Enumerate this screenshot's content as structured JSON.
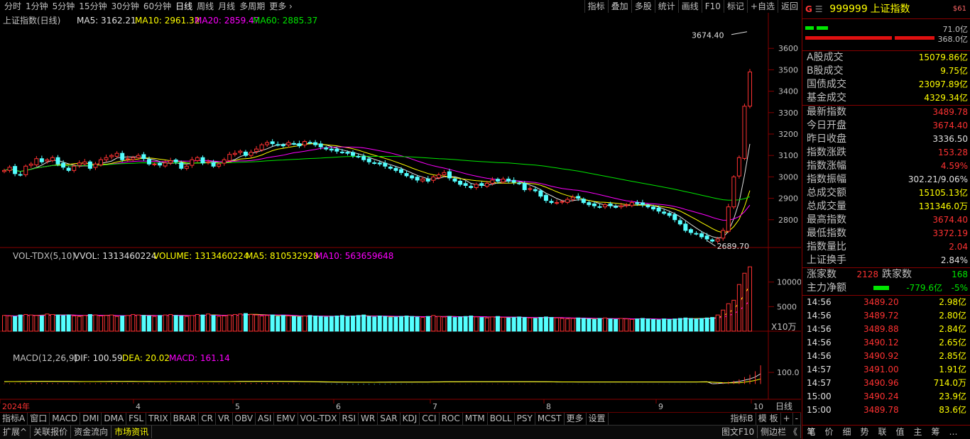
{
  "top_menu": {
    "periods": [
      "分时",
      "1分钟",
      "5分钟",
      "15分钟",
      "30分钟",
      "60分钟",
      "日线",
      "周线",
      "月线",
      "多周期",
      "更多 ›"
    ],
    "active": "日线",
    "right_buttons": [
      "指标",
      "叠加",
      "多股",
      "统计",
      "画线",
      "F10",
      "标记",
      "+自选",
      "返回"
    ]
  },
  "chart_header": {
    "name": "上证指数(日线)",
    "ma5": "MA5: 3162.21",
    "ma10": "MA10: 2961.32",
    "ma20": "MA20: 2859.47",
    "ma60": "MA60: 2885.37"
  },
  "annotations": {
    "high": "3674.40",
    "low": "2689.70"
  },
  "price_axis": [
    "3600",
    "3500",
    "3400",
    "3300",
    "3200",
    "3100",
    "3000",
    "2900",
    "2800"
  ],
  "vol_header": {
    "name": "VOL-TDX(5,10)",
    "vvol": "VVOL: 1313460224",
    "volume": "VOLUME: 1313460224",
    "ma5": "MA5: 810532928",
    "ma10": "MA10: 563659648"
  },
  "vol_axis": [
    "10000",
    "5000"
  ],
  "vol_unit": "X10万",
  "macd_header": {
    "name": "MACD(12,26,9)",
    "dif": "DIF: 100.59",
    "dea": "DEA: 20.02",
    "macd": "MACD: 161.14"
  },
  "macd_axis": [
    "100.0"
  ],
  "time_axis": [
    "2024年",
    "4",
    "5",
    "6",
    "7",
    "8",
    "9",
    "10"
  ],
  "period_label": "日线",
  "chart_data": {
    "type": "candlestick",
    "title": "上证指数(日线)",
    "annotations": {
      "high": 3674.4,
      "low": 2689.7
    },
    "last_ma": {
      "MA5": 3162.21,
      "MA10": 2961.32,
      "MA20": 2859.47,
      "MA60": 2885.37
    },
    "ylim": [
      2700,
      3700
    ],
    "vol_ylim": [
      0,
      14000
    ],
    "macd_ylim": [
      -40,
      180
    ],
    "last_volume": 1313460224,
    "last_vol_ma": {
      "MA5": 810532928,
      "MA10": 563659648
    },
    "last_macd": {
      "DIF": 100.59,
      "DEA": 20.02,
      "MACD": 161.14
    },
    "closes": [
      3030,
      3045,
      3015,
      3010,
      3050,
      3060,
      3085,
      3070,
      3080,
      3090,
      3060,
      3045,
      3030,
      3050,
      3065,
      3070,
      3040,
      3060,
      3080,
      3090,
      3100,
      3110,
      3080,
      3085,
      3090,
      3100,
      3085,
      3060,
      3060,
      3055,
      3065,
      3075,
      3070,
      3040,
      3050,
      3080,
      3090,
      3065,
      3070,
      3050,
      3060,
      3080,
      3105,
      3110,
      3120,
      3100,
      3115,
      3130,
      3150,
      3160,
      3155,
      3150,
      3145,
      3160,
      3155,
      3145,
      3165,
      3160,
      3150,
      3140,
      3130,
      3125,
      3120,
      3115,
      3110,
      3100,
      3095,
      3080,
      3070,
      3065,
      3060,
      3050,
      3040,
      3030,
      3020,
      3005,
      2995,
      2985,
      2990,
      2980,
      3000,
      3010,
      3020,
      2995,
      2980,
      2965,
      2960,
      2950,
      2965,
      2960,
      2970,
      2985,
      2980,
      2990,
      2980,
      2975,
      2970,
      2940,
      2945,
      2935,
      2910,
      2890,
      2880,
      2880,
      2885,
      2895,
      2905,
      2900,
      2880,
      2870,
      2865,
      2860,
      2870,
      2865,
      2860,
      2865,
      2870,
      2880,
      2875,
      2870,
      2860,
      2850,
      2840,
      2830,
      2820,
      2800,
      2780,
      2750,
      2740,
      2735,
      2720,
      2710,
      2700,
      2710,
      2750,
      2860,
      3000,
      3090,
      3330,
      3490
    ],
    "volumes": [
      3200,
      3100,
      3000,
      3300,
      3400,
      3300,
      3200,
      3100,
      3500,
      3400,
      3300,
      3200,
      3300,
      3100,
      3000,
      3200,
      3400,
      3300,
      3100,
      3200,
      3300,
      3000,
      3100,
      3200,
      3400,
      3300,
      3200,
      3100,
      3000,
      3200,
      3300,
      3400,
      3200,
      3100,
      3000,
      3200,
      3400,
      3300,
      3500,
      3200,
      3000,
      3100,
      3300,
      3400,
      3500,
      3600,
      3400,
      3300,
      3100,
      3200,
      3300,
      3000,
      3200,
      3100,
      3000,
      2900,
      3100,
      3200,
      3100,
      3000,
      2900,
      3000,
      3100,
      3200,
      3000,
      3100,
      3200,
      3300,
      3000,
      2900,
      3100,
      3000,
      2800,
      2900,
      3000,
      3100,
      3000,
      2900,
      2800,
      3000,
      3200,
      3000,
      2900,
      3000,
      2800,
      2900,
      3000,
      3100,
      2900,
      2800,
      2700,
      2900,
      3000,
      2800,
      2700,
      2800,
      2900,
      2800,
      2700,
      2600,
      2800,
      2900,
      2800,
      2700,
      2600,
      2500,
      2600,
      2700,
      2600,
      2500,
      2400,
      2600,
      2700,
      2500,
      2400,
      2600,
      2500,
      2400,
      2500,
      2600,
      2500,
      2400,
      2300,
      2500,
      2400,
      2500,
      2600,
      2700,
      2600,
      2500,
      2600,
      2700,
      2800,
      3300,
      4300,
      5600,
      6300,
      9500,
      11800,
      13100
    ],
    "macd": [
      5,
      6,
      6,
      7,
      7,
      8,
      8,
      8,
      9,
      8,
      7,
      6,
      6,
      5,
      5,
      6,
      6,
      6,
      7,
      7,
      8,
      8,
      7,
      7,
      7,
      6,
      6,
      5,
      5,
      5,
      5,
      6,
      6,
      5,
      5,
      5,
      6,
      6,
      6,
      5,
      5,
      5,
      6,
      7,
      8,
      8,
      8,
      8,
      9,
      9,
      9,
      8,
      7,
      6,
      5,
      4,
      3,
      2,
      1,
      -1,
      -2,
      -3,
      -4,
      -4,
      -5,
      -5,
      -5,
      -5,
      -5,
      -5,
      -4,
      -4,
      -3,
      -3,
      -3,
      -2,
      -2,
      -1,
      -1,
      -1,
      1,
      1,
      2,
      2,
      2,
      2,
      2,
      2,
      2,
      2,
      2,
      3,
      3,
      3,
      3,
      3,
      3,
      3,
      2,
      2,
      1,
      1,
      1,
      -1,
      -1,
      -1,
      -1,
      -1,
      -1,
      -1,
      -1,
      -1,
      -1,
      -1,
      -1,
      -1,
      -1,
      -1,
      -1,
      -1,
      -1,
      -1,
      -1,
      -1,
      -1,
      -1,
      -1,
      -1,
      -1,
      -1,
      1,
      2,
      4,
      8,
      14,
      20,
      28,
      40,
      60,
      80,
      110,
      161
    ]
  }
}
